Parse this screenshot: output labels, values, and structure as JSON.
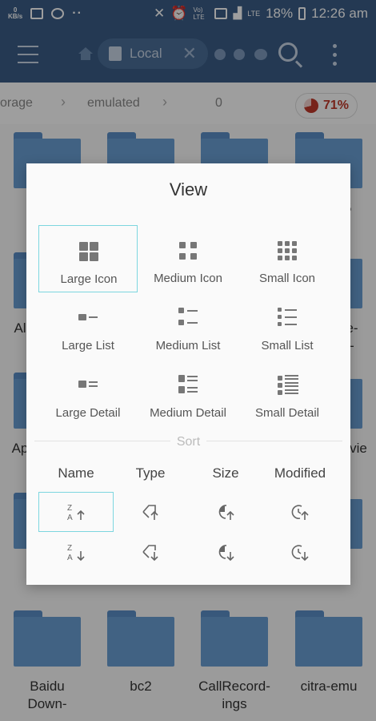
{
  "status_bar": {
    "speed": "0",
    "speed_unit": "KB/s",
    "dots": "··",
    "volte": "Vo) LTE",
    "network": "LTE",
    "battery": "18%",
    "time": "12:26 am"
  },
  "toolbar": {
    "tab_label": "Local"
  },
  "breadcrumb": {
    "items": [
      "orage",
      "emulated",
      "0"
    ],
    "usage": "71%"
  },
  "background": {
    "partial_labels": [
      "45",
      "Al",
      "e-",
      "-",
      "Ap",
      "vie"
    ],
    "folders": [
      {
        "label_line1": "Baidu",
        "label_line2": "Down-"
      },
      {
        "label_line1": "bc2",
        "label_line2": ""
      },
      {
        "label_line1": "CallRecord-",
        "label_line2": "ings"
      },
      {
        "label_line1": "citra-emu",
        "label_line2": ""
      }
    ]
  },
  "dialog": {
    "title": "View",
    "view_options": [
      {
        "label": "Large Icon",
        "icon": "large-icon-icon",
        "selected": true
      },
      {
        "label": "Medium Icon",
        "icon": "medium-icon-icon",
        "selected": false
      },
      {
        "label": "Small Icon",
        "icon": "small-icon-icon",
        "selected": false
      },
      {
        "label": "Large List",
        "icon": "large-list-icon",
        "selected": false
      },
      {
        "label": "Medium List",
        "icon": "medium-list-icon",
        "selected": false
      },
      {
        "label": "Small List",
        "icon": "small-list-icon",
        "selected": false
      },
      {
        "label": "Large Detail",
        "icon": "large-detail-icon",
        "selected": false
      },
      {
        "label": "Medium Detail",
        "icon": "medium-detail-icon",
        "selected": false
      },
      {
        "label": "Small Detail",
        "icon": "small-detail-icon",
        "selected": false
      }
    ],
    "sort_title": "Sort",
    "sort_headers": [
      "Name",
      "Type",
      "Size",
      "Modified"
    ],
    "colors": {
      "accent": "#7dd6df",
      "toolbar": "#3a5d87",
      "folder": "#6a9fd4",
      "usage": "#c0392b"
    }
  }
}
